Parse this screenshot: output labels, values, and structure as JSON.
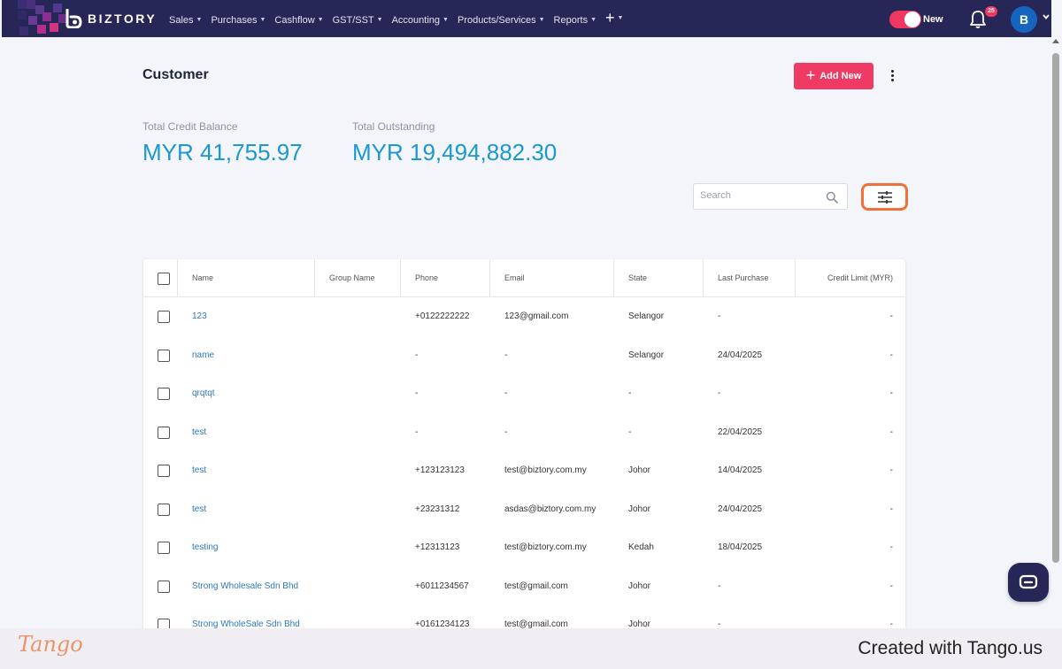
{
  "nav": {
    "brand": "BIZTORY",
    "menu": [
      {
        "label": "Sales"
      },
      {
        "label": "Purchases"
      },
      {
        "label": "Cashflow"
      },
      {
        "label": "GST/SST"
      },
      {
        "label": "Accounting"
      },
      {
        "label": "Products/Services"
      },
      {
        "label": "Reports"
      }
    ],
    "plus_label": "+",
    "toggle_label": "New",
    "notification_count": "25",
    "avatar_initial": "B"
  },
  "page": {
    "title": "Customer",
    "add_button_label": "Add New"
  },
  "stats": {
    "credit_label": "Total Credit Balance",
    "credit_value": "MYR 41,755.97",
    "outstanding_label": "Total Outstanding",
    "outstanding_value": "MYR 19,494,882.30"
  },
  "search": {
    "placeholder": "Search"
  },
  "table": {
    "columns": [
      "Name",
      "Group Name",
      "Phone",
      "Email",
      "State",
      "Last Purchase",
      "Credit Limit (MYR)"
    ],
    "rows": [
      {
        "name": "123",
        "group": "",
        "phone": "+0122222222",
        "email": "123@gmail.com",
        "state": "Selangor",
        "last_purchase": "-",
        "credit_limit": "-"
      },
      {
        "name": "name",
        "group": "",
        "phone": "-",
        "email": "-",
        "state": "Selangor",
        "last_purchase": "24/04/2025",
        "credit_limit": "-"
      },
      {
        "name": "qrqtqt",
        "group": "",
        "phone": "-",
        "email": "-",
        "state": "-",
        "last_purchase": "-",
        "credit_limit": "-"
      },
      {
        "name": "test",
        "group": "",
        "phone": "-",
        "email": "-",
        "state": "-",
        "last_purchase": "22/04/2025",
        "credit_limit": "-"
      },
      {
        "name": "test",
        "group": "",
        "phone": "+123123123",
        "email": "test@biztory.com.my",
        "state": "Johor",
        "last_purchase": "14/04/2025",
        "credit_limit": "-"
      },
      {
        "name": "test",
        "group": "",
        "phone": "+23231312",
        "email": "asdas@biztory.com.my",
        "state": "Johor",
        "last_purchase": "24/04/2025",
        "credit_limit": "-"
      },
      {
        "name": "testing",
        "group": "",
        "phone": "+12313123",
        "email": "test@biztory.com.my",
        "state": "Kedah",
        "last_purchase": "18/04/2025",
        "credit_limit": "-"
      },
      {
        "name": "Strong Wholesale Sdn Bhd",
        "group": "",
        "phone": "+6011234567",
        "email": "test@gmail.com",
        "state": "Johor",
        "last_purchase": "-",
        "credit_limit": "-"
      },
      {
        "name": "Strong WholeSale Sdn Bhd",
        "group": "",
        "phone": "+0161234123",
        "email": "test@gmail.com",
        "state": "Johor",
        "last_purchase": "-",
        "credit_limit": "-"
      }
    ]
  },
  "footer": {
    "logo": "Tango",
    "created_text": "Created with Tango.us"
  },
  "colors": {
    "nav_bg": "#262757",
    "accent": "#ef3b63",
    "stat_value": "#1b98d0",
    "link": "#2e78b9",
    "highlight": "#f0703a"
  },
  "icons": [
    "logo-icon",
    "chevron-down-icon",
    "plus-icon",
    "bell-icon",
    "more-vertical-icon",
    "search-icon",
    "filter-sliders-icon",
    "chat-icon"
  ]
}
